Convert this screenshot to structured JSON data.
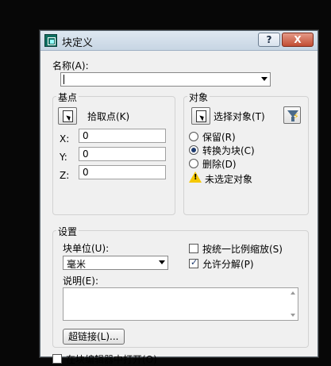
{
  "window": {
    "title": "块定义"
  },
  "titlebar": {
    "help_label": "?",
    "close_label": "X"
  },
  "name": {
    "label": "名称(A):",
    "value": ""
  },
  "base_point": {
    "group_label": "基点",
    "pick_label": "拾取点(K)",
    "x_label": "X:",
    "x_value": "0",
    "y_label": "Y:",
    "y_value": "0",
    "z_label": "Z:",
    "z_value": "0"
  },
  "objects": {
    "group_label": "对象",
    "select_label": "选择对象(T)",
    "retain_label": "保留(R)",
    "convert_label": "转换为块(C)",
    "delete_label": "删除(D)",
    "status_text": "未选定对象",
    "selected_option": "convert"
  },
  "settings": {
    "group_label": "设置",
    "unit_label": "块单位(U):",
    "unit_value": "毫米",
    "uniform_scale_label": "按统一比例缩放(S)",
    "uniform_scale_checked": false,
    "allow_explode_label": "允许分解(P)",
    "allow_explode_checked": true,
    "description_label": "说明(E):",
    "description_value": "",
    "hyperlink_label": "超链接(L)..."
  },
  "open_in_editor": {
    "label": "在块编辑器中打开(O)",
    "checked": false
  },
  "icons": {
    "app": "block-definition-icon",
    "pick": "pick-point-icon",
    "select": "select-objects-icon",
    "filter": "quick-select-icon",
    "warning": "warning-icon"
  },
  "colors": {
    "background": "#070707",
    "dialog": "#f0f0f0",
    "close": "#c24d33"
  }
}
